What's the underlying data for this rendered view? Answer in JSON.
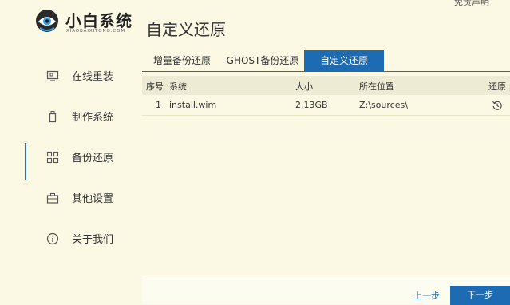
{
  "header": {
    "disclaimer": "免责声明",
    "logo_title": "小白系统",
    "logo_subtitle": "XIAOBAIXITONG.COM",
    "page_title": "自定义还原"
  },
  "sidebar": {
    "items": [
      {
        "label": "在线重装",
        "icon": "monitor-icon"
      },
      {
        "label": "制作系统",
        "icon": "usb-drive-icon"
      },
      {
        "label": "备份还原",
        "icon": "grid-icon"
      },
      {
        "label": "其他设置",
        "icon": "toolbox-icon"
      },
      {
        "label": "关于我们",
        "icon": "info-icon"
      }
    ],
    "active_index": 2
  },
  "tabs": [
    {
      "label": "增量备份还原"
    },
    {
      "label": "GHOST备份还原"
    },
    {
      "label": "自定义还原"
    }
  ],
  "table": {
    "headers": [
      "序号",
      "系统",
      "大小",
      "所在位置",
      "还原"
    ],
    "rows": [
      {
        "index": "1",
        "system": "install.wim",
        "size": "2.13GB",
        "location": "Z:\\sources\\"
      }
    ]
  },
  "footer": {
    "prev_label": "上一步",
    "next_label": "下一步"
  },
  "colors": {
    "accent": "#1d6bb3",
    "background": "#fbf9e3"
  }
}
